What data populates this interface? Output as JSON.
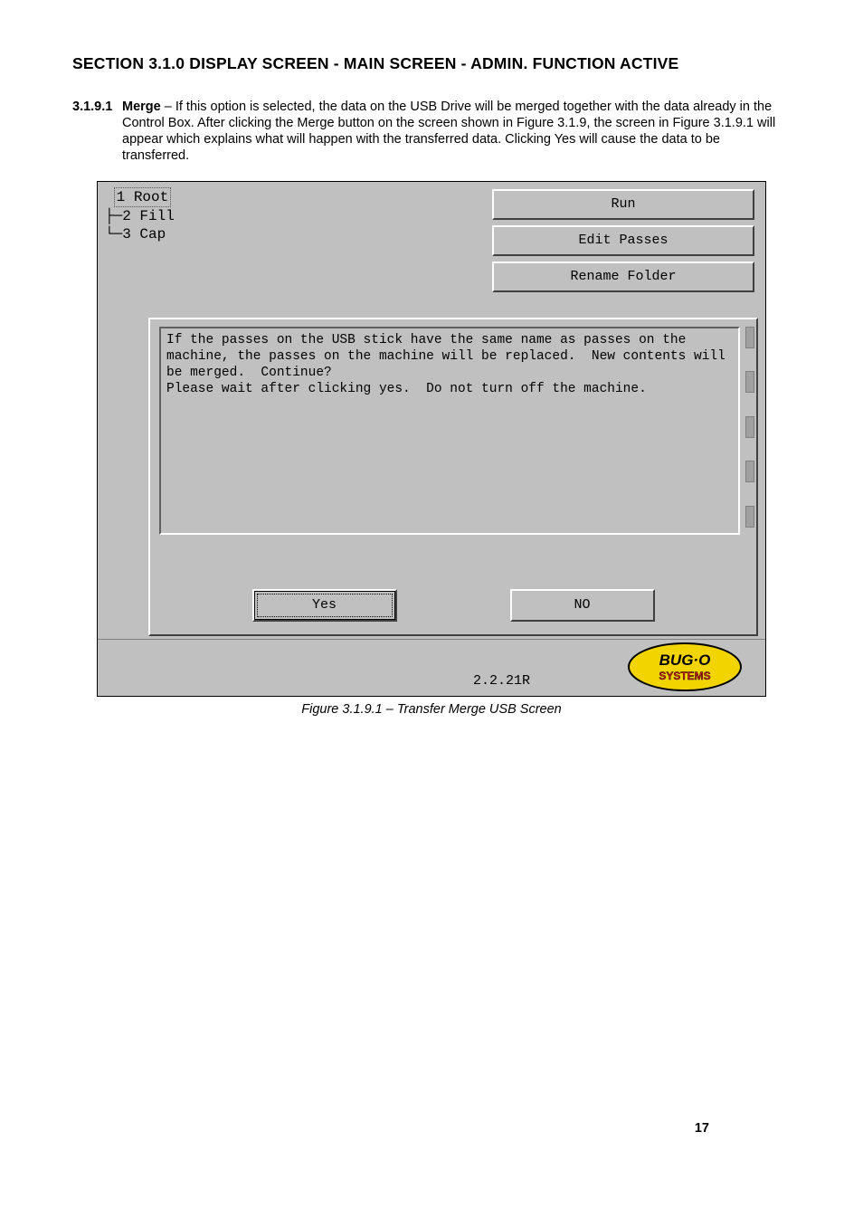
{
  "section_heading": "SECTION 3.1.0 DISPLAY SCREEN - MAIN SCREEN - ADMIN. FUNCTION ACTIVE",
  "paragraph": {
    "number": "3.1.9.1",
    "label": "Merge",
    "text": " – If this option is selected, the data on the USB Drive will be merged together with the data already in the Control Box. After clicking the Merge button on the screen shown in Figure 3.1.9, the screen in Figure 3.1.9.1 will appear which explains what will happen with the transferred data. Clicking Yes will cause the data to be transferred."
  },
  "screenshot": {
    "tree": {
      "items": [
        {
          "prefix": "",
          "text": "1 Root",
          "selected": true
        },
        {
          "prefix": "├─",
          "text": "2 Fill",
          "selected": false
        },
        {
          "prefix": "└─",
          "text": "3 Cap",
          "selected": false
        }
      ]
    },
    "side_buttons": [
      "Run",
      "Edit Passes",
      "Rename Folder"
    ],
    "dialog": {
      "message": "If the passes on the USB stick have the same name as passes on the machine, the passes on the machine will be replaced.  New contents will be merged.  Continue?\nPlease wait after clicking yes.  Do not turn off the machine.",
      "yes": "Yes",
      "no": "NO"
    },
    "version": "2.2.21R",
    "logo_text_top": "BUG·O",
    "logo_text_bottom": "SYSTEMS"
  },
  "caption": "Figure 3.1.9.1 – Transfer Merge USB Screen",
  "page_number": "17"
}
